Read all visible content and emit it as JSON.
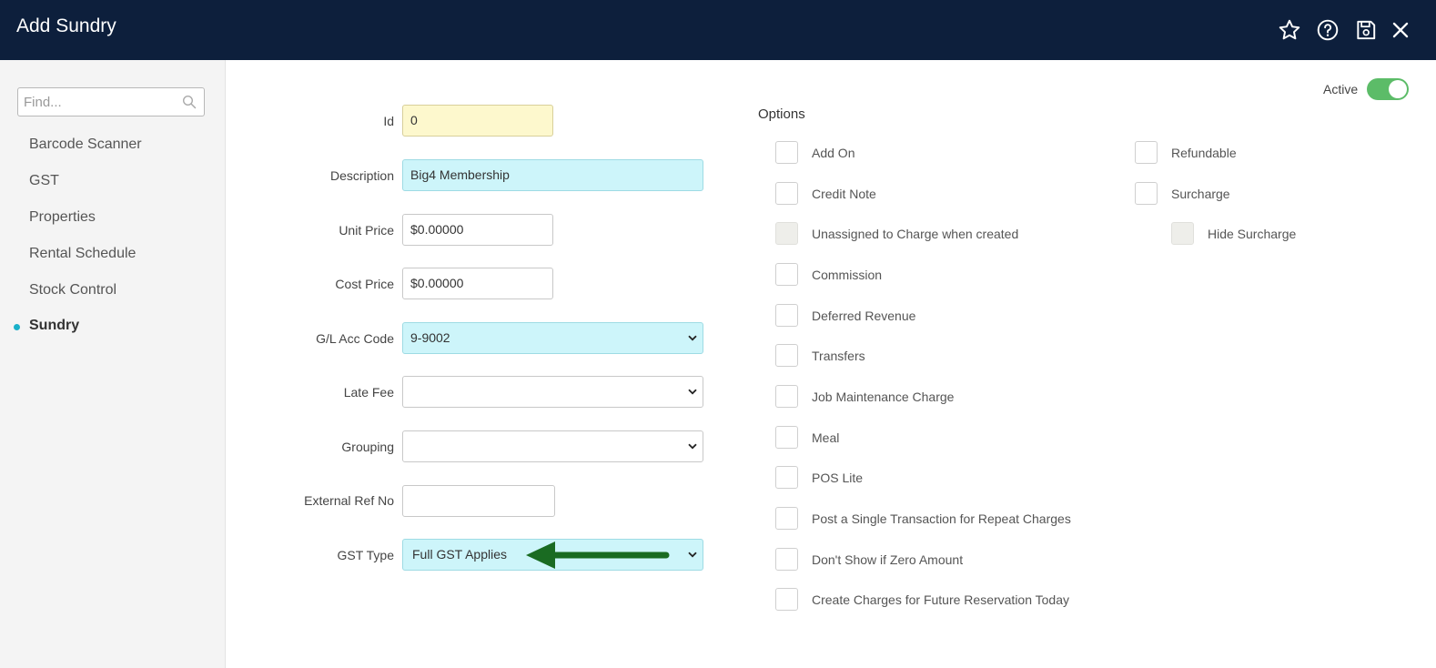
{
  "window": {
    "title": "Add Sundry"
  },
  "toolbar": {
    "icons": [
      "star-icon",
      "help-icon",
      "save-icon",
      "close-icon"
    ]
  },
  "sidebar": {
    "search_placeholder": "Find...",
    "items": [
      {
        "label": "Barcode Scanner"
      },
      {
        "label": "GST"
      },
      {
        "label": "Properties"
      },
      {
        "label": "Rental Schedule"
      },
      {
        "label": "Stock Control"
      },
      {
        "label": "Sundry",
        "active": true
      }
    ]
  },
  "form": {
    "id": {
      "label": "Id",
      "value": "0"
    },
    "description": {
      "label": "Description",
      "value": "Big4 Membership"
    },
    "unit_price": {
      "label": "Unit Price",
      "value": "$0.00000"
    },
    "cost_price": {
      "label": "Cost Price",
      "value": "$0.00000"
    },
    "gl_acc_code": {
      "label": "G/L Acc Code",
      "value": "9-9002"
    },
    "late_fee": {
      "label": "Late Fee",
      "value": ""
    },
    "grouping": {
      "label": "Grouping",
      "value": ""
    },
    "external_ref_no": {
      "label": "External Ref No",
      "value": ""
    },
    "gst_type": {
      "label": "GST Type",
      "value": "Full GST Applies"
    }
  },
  "status": {
    "active_label": "Active",
    "active": true
  },
  "options": {
    "title": "Options",
    "left": [
      {
        "label": "Add On",
        "checked": false,
        "disabled": false
      },
      {
        "label": "Credit Note",
        "checked": false,
        "disabled": false
      },
      {
        "label": "Unassigned to Charge when created",
        "checked": false,
        "disabled": true
      },
      {
        "label": "Commission",
        "checked": false,
        "disabled": false
      },
      {
        "label": "Deferred Revenue",
        "checked": false,
        "disabled": false
      },
      {
        "label": "Transfers",
        "checked": false,
        "disabled": false
      },
      {
        "label": "Job Maintenance Charge",
        "checked": false,
        "disabled": false
      },
      {
        "label": "Meal",
        "checked": false,
        "disabled": false
      },
      {
        "label": "POS Lite",
        "checked": false,
        "disabled": false
      },
      {
        "label": "Post a Single Transaction for Repeat Charges",
        "checked": false,
        "disabled": false
      },
      {
        "label": "Don't Show if Zero Amount",
        "checked": false,
        "disabled": false
      },
      {
        "label": "Create Charges for Future Reservation Today",
        "checked": false,
        "disabled": false
      }
    ],
    "right": [
      {
        "label": "Refundable",
        "checked": false,
        "disabled": false
      },
      {
        "label": "Surcharge",
        "checked": false,
        "disabled": false
      },
      {
        "label": "Hide Surcharge",
        "checked": false,
        "disabled": true
      }
    ]
  },
  "colors": {
    "header_bg": "#0d1f3c",
    "accent": "#1ab0c9",
    "toggle_on": "#5cbc68",
    "annotation_arrow": "#1a6b22"
  }
}
